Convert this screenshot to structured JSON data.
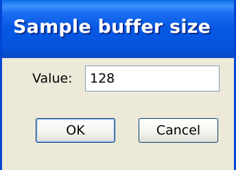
{
  "window": {
    "title": "Sample buffer size"
  },
  "form": {
    "value_label": "Value:",
    "value": "128"
  },
  "buttons": {
    "ok_label": "OK",
    "cancel_label": "Cancel"
  },
  "colors": {
    "titlebar": "#0758e3",
    "dialog_background": "#ece9d8",
    "input_border": "#7f9db9",
    "button_border": "#003c74"
  }
}
